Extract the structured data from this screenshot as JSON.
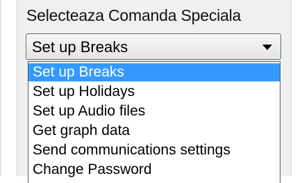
{
  "heading": "Selecteaza Comanda Speciala",
  "combo": {
    "selected_value": "Set up Breaks"
  },
  "dropdown": {
    "options": [
      "Set up Breaks",
      "Set up Holidays",
      "Set up Audio files",
      "Get graph data",
      "Send communications settings",
      "Change Password"
    ],
    "highlighted_option": "Set up Breaks"
  },
  "colors": {
    "highlight": "#3399ff",
    "panel_background": "#f0f0f0"
  },
  "icons": {
    "combo_arrow": "chevron-down-icon"
  }
}
